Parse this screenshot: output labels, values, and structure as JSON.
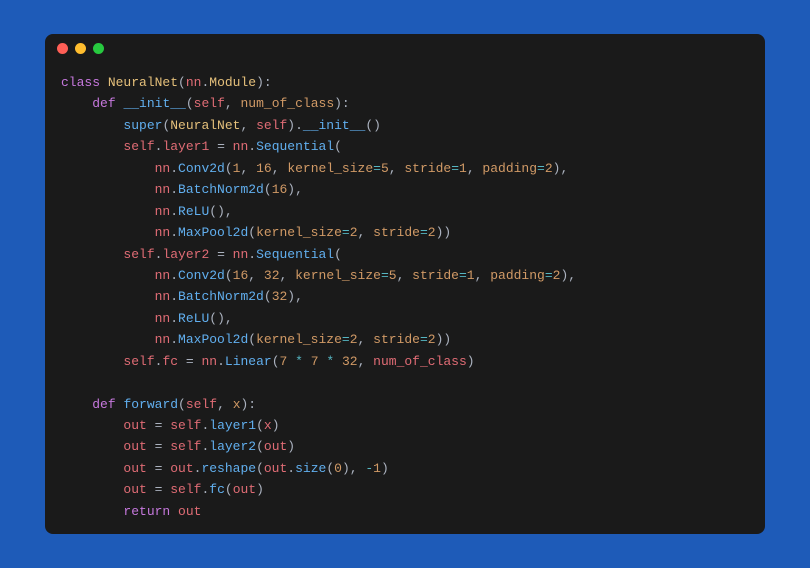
{
  "code": {
    "line1": {
      "kw": "class",
      "cls": "NeuralNet",
      "p1": "(",
      "id": "nn",
      "dot": ".",
      "mod": "Module",
      "p2": "):"
    },
    "line2": {
      "indent": "    ",
      "kw": "def",
      "fn": "__init__",
      "p1": "(",
      "self": "self",
      "c": ", ",
      "param": "num_of_class",
      "p2": "):"
    },
    "line3": {
      "indent": "        ",
      "fn": "super",
      "p1": "(",
      "cls": "NeuralNet",
      "c": ", ",
      "self": "self",
      "p2": ").",
      "init": "__init__",
      "p3": "()"
    },
    "line4": {
      "indent": "        ",
      "self": "self",
      "dot": ".",
      "attr": "layer1",
      "eq": " = ",
      "nn": "nn",
      "dot2": ".",
      "seq": "Sequential",
      "p": "("
    },
    "line5": {
      "indent": "            ",
      "nn": "nn",
      "dot": ".",
      "fn": "Conv2d",
      "p1": "(",
      "n1": "1",
      "c1": ", ",
      "n2": "16",
      "c2": ", ",
      "k1": "kernel_size",
      "eq1": "=",
      "n3": "5",
      "c3": ", ",
      "k2": "stride",
      "eq2": "=",
      "n4": "1",
      "c4": ", ",
      "k3": "padding",
      "eq3": "=",
      "n5": "2",
      "p2": "),"
    },
    "line6": {
      "indent": "            ",
      "nn": "nn",
      "dot": ".",
      "fn": "BatchNorm2d",
      "p1": "(",
      "n": "16",
      "p2": "),"
    },
    "line7": {
      "indent": "            ",
      "nn": "nn",
      "dot": ".",
      "fn": "ReLU",
      "p": "(),"
    },
    "line8": {
      "indent": "            ",
      "nn": "nn",
      "dot": ".",
      "fn": "MaxPool2d",
      "p1": "(",
      "k1": "kernel_size",
      "eq1": "=",
      "n1": "2",
      "c": ", ",
      "k2": "stride",
      "eq2": "=",
      "n2": "2",
      "p2": "))"
    },
    "line9": {
      "indent": "        ",
      "self": "self",
      "dot": ".",
      "attr": "layer2",
      "eq": " = ",
      "nn": "nn",
      "dot2": ".",
      "seq": "Sequential",
      "p": "("
    },
    "line10": {
      "indent": "            ",
      "nn": "nn",
      "dot": ".",
      "fn": "Conv2d",
      "p1": "(",
      "n1": "16",
      "c1": ", ",
      "n2": "32",
      "c2": ", ",
      "k1": "kernel_size",
      "eq1": "=",
      "n3": "5",
      "c3": ", ",
      "k2": "stride",
      "eq2": "=",
      "n4": "1",
      "c4": ", ",
      "k3": "padding",
      "eq3": "=",
      "n5": "2",
      "p2": "),"
    },
    "line11": {
      "indent": "            ",
      "nn": "nn",
      "dot": ".",
      "fn": "BatchNorm2d",
      "p1": "(",
      "n": "32",
      "p2": "),"
    },
    "line12": {
      "indent": "            ",
      "nn": "nn",
      "dot": ".",
      "fn": "ReLU",
      "p": "(),"
    },
    "line13": {
      "indent": "            ",
      "nn": "nn",
      "dot": ".",
      "fn": "MaxPool2d",
      "p1": "(",
      "k1": "kernel_size",
      "eq1": "=",
      "n1": "2",
      "c": ", ",
      "k2": "stride",
      "eq2": "=",
      "n2": "2",
      "p2": "))"
    },
    "line14": {
      "indent": "        ",
      "self": "self",
      "dot": ".",
      "attr": "fc",
      "eq": " = ",
      "nn": "nn",
      "dot2": ".",
      "fn": "Linear",
      "p1": "(",
      "n1": "7",
      "op1": " * ",
      "n2": "7",
      "op2": " * ",
      "n3": "32",
      "c": ", ",
      "param": "num_of_class",
      "p2": ")"
    },
    "line15": "",
    "line16": {
      "indent": "    ",
      "kw": "def",
      "fn": "forward",
      "p1": "(",
      "self": "self",
      "c": ", ",
      "param": "x",
      "p2": "):"
    },
    "line17": {
      "indent": "        ",
      "out": "out",
      "eq": " = ",
      "self": "self",
      "dot": ".",
      "fn": "layer1",
      "p1": "(",
      "x": "x",
      "p2": ")"
    },
    "line18": {
      "indent": "        ",
      "out": "out",
      "eq": " = ",
      "self": "self",
      "dot": ".",
      "fn": "layer2",
      "p1": "(",
      "x": "out",
      "p2": ")"
    },
    "line19": {
      "indent": "        ",
      "out": "out",
      "eq": " = ",
      "out2": "out",
      "dot": ".",
      "fn": "reshape",
      "p1": "(",
      "out3": "out",
      "dot2": ".",
      "fn2": "size",
      "p2": "(",
      "n": "0",
      "p3": "), ",
      "neg": "-",
      "n2": "1",
      "p4": ")"
    },
    "line20": {
      "indent": "        ",
      "out": "out",
      "eq": " = ",
      "self": "self",
      "dot": ".",
      "fn": "fc",
      "p1": "(",
      "x": "out",
      "p2": ")"
    },
    "line21": {
      "indent": "        ",
      "kw": "return",
      "sp": " ",
      "out": "out"
    }
  }
}
